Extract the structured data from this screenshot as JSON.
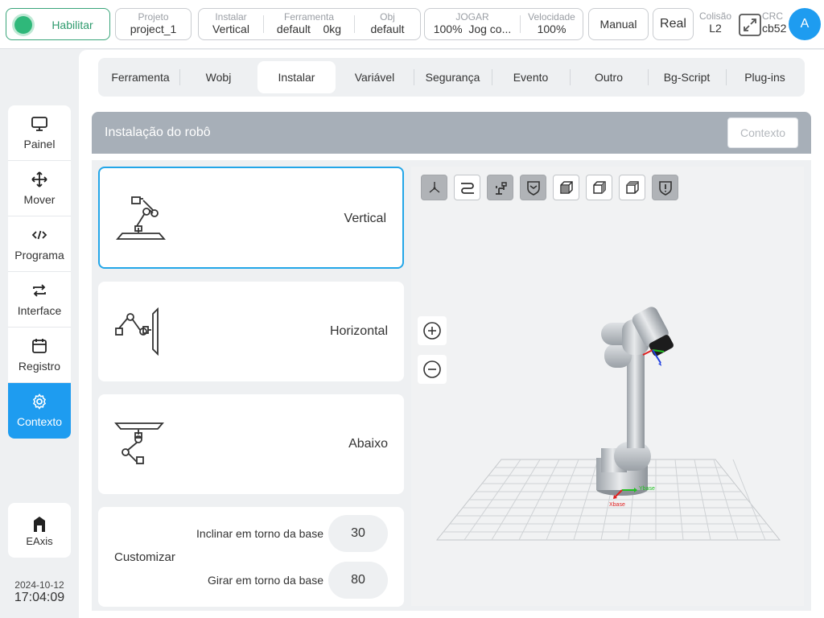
{
  "topbar": {
    "enable_label": "Habilitar",
    "project": {
      "label": "Projeto",
      "value": "project_1"
    },
    "install": {
      "label": "Instalar",
      "value": "Vertical"
    },
    "tool": {
      "label": "Ferramenta",
      "value": "default",
      "mass": "0kg"
    },
    "obj": {
      "label": "Obj",
      "value": "default"
    },
    "jog": {
      "label": "JOGAR",
      "value": "100%",
      "mode": "Jog co..."
    },
    "speed": {
      "label": "Velocidade",
      "value": "100%"
    },
    "manual_label": "Manual",
    "real_label": "Real",
    "collision": {
      "label": "Colisão",
      "value": "L2"
    },
    "crc": {
      "label": "CRC",
      "value": "cb52"
    },
    "avatar_letter": "A"
  },
  "sidebar": {
    "items": [
      {
        "label": "Painel",
        "icon": "monitor-icon"
      },
      {
        "label": "Mover",
        "icon": "move-icon"
      },
      {
        "label": "Programa",
        "icon": "code-icon"
      },
      {
        "label": "Interface",
        "icon": "swap-icon"
      },
      {
        "label": "Registro",
        "icon": "calendar-icon"
      },
      {
        "label": "Contexto",
        "icon": "gear-icon",
        "active": true
      }
    ],
    "eaxis_label": "EAxis",
    "date": "2024-10-12",
    "time": "17:04:09"
  },
  "tabs": [
    "Ferramenta",
    "Wobj",
    "Instalar",
    "Variável",
    "Segurança",
    "Evento",
    "Outro",
    "Bg-Script",
    "Plug-ins"
  ],
  "active_tab": "Instalar",
  "panel": {
    "title": "Instalação do robô",
    "context_button": "Contexto"
  },
  "mount_options": [
    {
      "label": "Vertical",
      "selected": true
    },
    {
      "label": "Horizontal",
      "selected": false
    },
    {
      "label": "Abaixo",
      "selected": false
    }
  ],
  "custom": {
    "label": "Customizar",
    "tilt_label": "Inclinar em torno da base",
    "tilt_value": "30",
    "rotate_label": "Girar em torno da base",
    "rotate_value": "80"
  },
  "viewer": {
    "toolbar_icons": [
      "axes-icon",
      "path-icon",
      "robot-icon",
      "shield-check-icon",
      "cube-front-icon",
      "cube-side-icon",
      "cube-top-icon",
      "shield-alert-icon"
    ],
    "axis_labels": {
      "x": "Xbase",
      "y": "Ybase"
    },
    "colors": {
      "x_axis": "#e02020",
      "y_axis": "#22c022",
      "z_axis": "#2040e0"
    }
  },
  "colors": {
    "accent": "#1e9cf0",
    "enable": "#2fb87a",
    "header": "#a7afb8"
  }
}
